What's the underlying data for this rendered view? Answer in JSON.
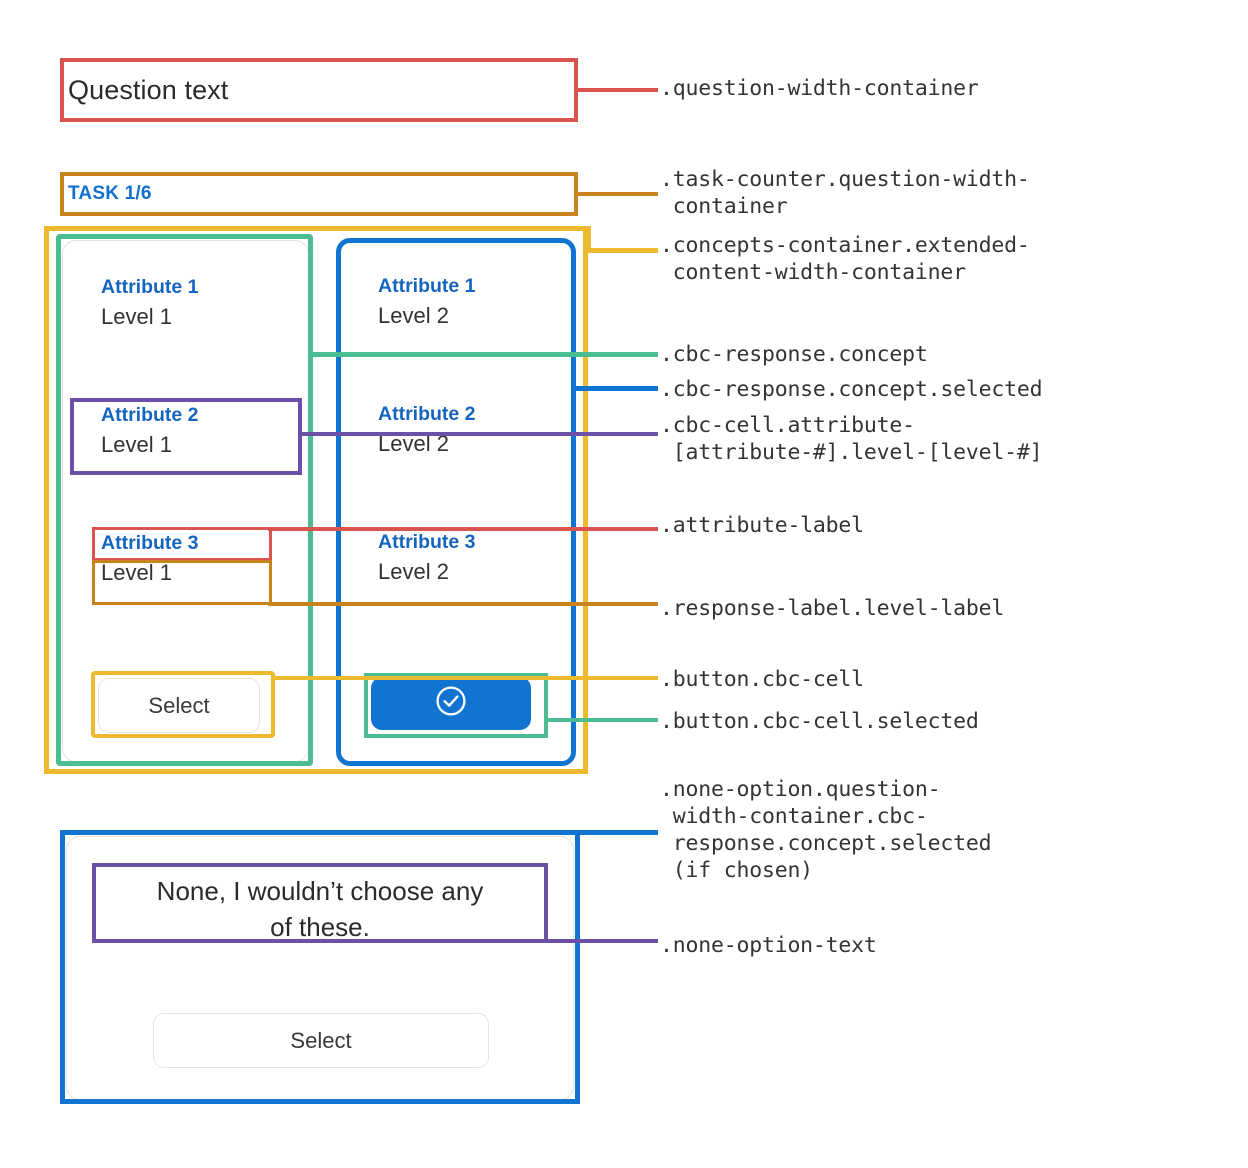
{
  "mock": {
    "question_text": "Question text",
    "task_counter": "TASK 1/6",
    "concepts": [
      {
        "name": "concept-left",
        "selected": false,
        "cells": [
          {
            "attribute": "Attribute 1",
            "level": "Level 1"
          },
          {
            "attribute": "Attribute 2",
            "level": "Level 1"
          },
          {
            "attribute": "Attribute 3",
            "level": "Level 1"
          }
        ],
        "button_label": "Select"
      },
      {
        "name": "concept-right",
        "selected": true,
        "cells": [
          {
            "attribute": "Attribute 1",
            "level": "Level 2"
          },
          {
            "attribute": "Attribute 2",
            "level": "Level 2"
          },
          {
            "attribute": "Attribute 3",
            "level": "Level 2"
          }
        ],
        "button_label": "",
        "button_icon": "check-circle-icon"
      }
    ],
    "none_option": {
      "text": "None, I wouldn’t choose any of these.",
      "text_line_1": "None, I wouldn’t choose any",
      "text_line_2": "of these.",
      "button_label": "Select"
    }
  },
  "annotations": [
    {
      "id": "question-width-container",
      "text": ".question-width-container",
      "color": "#d9534f"
    },
    {
      "id": "task-counter",
      "text": ".task-counter.question-width-\n container",
      "color": "#c8821e"
    },
    {
      "id": "concepts-container",
      "text": ".concepts-container.extended-\n content-width-container",
      "color": "#edb92e"
    },
    {
      "id": "cbc-response-concept",
      "text": ".cbc-response.concept",
      "color": "#4cbc93"
    },
    {
      "id": "cbc-response-concept-selected",
      "text": ".cbc-response.concept.selected",
      "color": "#1174d1"
    },
    {
      "id": "cbc-cell-attribute-level",
      "text": ".cbc-cell.attribute-\n [attribute-#].level-[level-#]",
      "color": "#6b4fa8"
    },
    {
      "id": "attribute-label",
      "text": ".attribute-label",
      "color": "#d9534f"
    },
    {
      "id": "response-label-level-label",
      "text": ".response-label.level-label",
      "color": "#c8821e"
    },
    {
      "id": "button-cbc-cell",
      "text": ".button.cbc-cell",
      "color": "#edb92e"
    },
    {
      "id": "button-cbc-cell-selected",
      "text": ".button.cbc-cell.selected",
      "color": "#4cbc93"
    },
    {
      "id": "none-option-container",
      "text": ".none-option.question-\n width-container.cbc-\n response.concept.selected\n (if chosen)",
      "color": "#1174d1"
    },
    {
      "id": "none-option-text",
      "text": ".none-option-text",
      "color": "#6b4fa8"
    }
  ],
  "colors": {
    "red": "#d9534f",
    "orange": "#c8821e",
    "yellow": "#edb92e",
    "green": "#4cbc93",
    "blue": "#1174d1",
    "purple": "#6b4fa8",
    "attribute_blue": "#1565c0",
    "text_dark": "#2b2b2b"
  }
}
